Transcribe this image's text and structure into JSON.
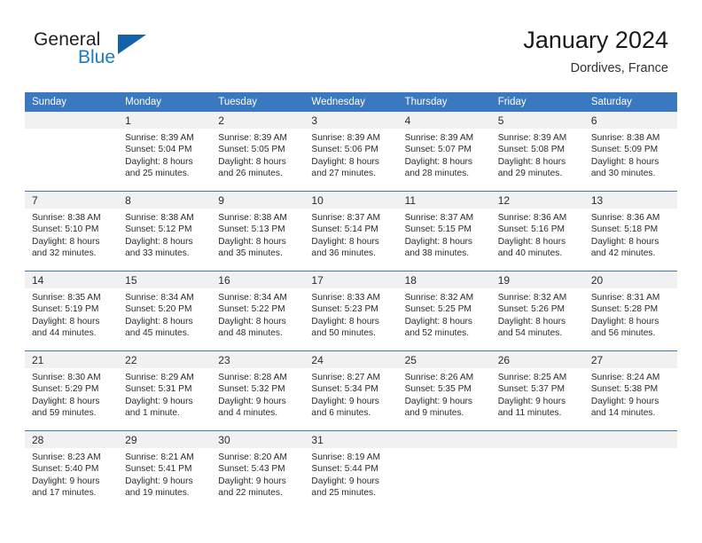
{
  "brand": {
    "word_general": "General",
    "word_blue": "Blue"
  },
  "header": {
    "title": "January 2024",
    "subtitle": "Dordives, France"
  },
  "colors": {
    "header_blue": "#3a78bf",
    "brand_blue": "#1a7bc4",
    "daynum_band": "#f1f1f1",
    "text": "#2b2b2b"
  },
  "weekdays": [
    "Sunday",
    "Monday",
    "Tuesday",
    "Wednesday",
    "Thursday",
    "Friday",
    "Saturday"
  ],
  "weeks": [
    [
      {
        "day": "",
        "sunrise": "",
        "sunset": "",
        "daylight1": "",
        "daylight2": ""
      },
      {
        "day": "1",
        "sunrise": "Sunrise: 8:39 AM",
        "sunset": "Sunset: 5:04 PM",
        "daylight1": "Daylight: 8 hours",
        "daylight2": "and 25 minutes."
      },
      {
        "day": "2",
        "sunrise": "Sunrise: 8:39 AM",
        "sunset": "Sunset: 5:05 PM",
        "daylight1": "Daylight: 8 hours",
        "daylight2": "and 26 minutes."
      },
      {
        "day": "3",
        "sunrise": "Sunrise: 8:39 AM",
        "sunset": "Sunset: 5:06 PM",
        "daylight1": "Daylight: 8 hours",
        "daylight2": "and 27 minutes."
      },
      {
        "day": "4",
        "sunrise": "Sunrise: 8:39 AM",
        "sunset": "Sunset: 5:07 PM",
        "daylight1": "Daylight: 8 hours",
        "daylight2": "and 28 minutes."
      },
      {
        "day": "5",
        "sunrise": "Sunrise: 8:39 AM",
        "sunset": "Sunset: 5:08 PM",
        "daylight1": "Daylight: 8 hours",
        "daylight2": "and 29 minutes."
      },
      {
        "day": "6",
        "sunrise": "Sunrise: 8:38 AM",
        "sunset": "Sunset: 5:09 PM",
        "daylight1": "Daylight: 8 hours",
        "daylight2": "and 30 minutes."
      }
    ],
    [
      {
        "day": "7",
        "sunrise": "Sunrise: 8:38 AM",
        "sunset": "Sunset: 5:10 PM",
        "daylight1": "Daylight: 8 hours",
        "daylight2": "and 32 minutes."
      },
      {
        "day": "8",
        "sunrise": "Sunrise: 8:38 AM",
        "sunset": "Sunset: 5:12 PM",
        "daylight1": "Daylight: 8 hours",
        "daylight2": "and 33 minutes."
      },
      {
        "day": "9",
        "sunrise": "Sunrise: 8:38 AM",
        "sunset": "Sunset: 5:13 PM",
        "daylight1": "Daylight: 8 hours",
        "daylight2": "and 35 minutes."
      },
      {
        "day": "10",
        "sunrise": "Sunrise: 8:37 AM",
        "sunset": "Sunset: 5:14 PM",
        "daylight1": "Daylight: 8 hours",
        "daylight2": "and 36 minutes."
      },
      {
        "day": "11",
        "sunrise": "Sunrise: 8:37 AM",
        "sunset": "Sunset: 5:15 PM",
        "daylight1": "Daylight: 8 hours",
        "daylight2": "and 38 minutes."
      },
      {
        "day": "12",
        "sunrise": "Sunrise: 8:36 AM",
        "sunset": "Sunset: 5:16 PM",
        "daylight1": "Daylight: 8 hours",
        "daylight2": "and 40 minutes."
      },
      {
        "day": "13",
        "sunrise": "Sunrise: 8:36 AM",
        "sunset": "Sunset: 5:18 PM",
        "daylight1": "Daylight: 8 hours",
        "daylight2": "and 42 minutes."
      }
    ],
    [
      {
        "day": "14",
        "sunrise": "Sunrise: 8:35 AM",
        "sunset": "Sunset: 5:19 PM",
        "daylight1": "Daylight: 8 hours",
        "daylight2": "and 44 minutes."
      },
      {
        "day": "15",
        "sunrise": "Sunrise: 8:34 AM",
        "sunset": "Sunset: 5:20 PM",
        "daylight1": "Daylight: 8 hours",
        "daylight2": "and 45 minutes."
      },
      {
        "day": "16",
        "sunrise": "Sunrise: 8:34 AM",
        "sunset": "Sunset: 5:22 PM",
        "daylight1": "Daylight: 8 hours",
        "daylight2": "and 48 minutes."
      },
      {
        "day": "17",
        "sunrise": "Sunrise: 8:33 AM",
        "sunset": "Sunset: 5:23 PM",
        "daylight1": "Daylight: 8 hours",
        "daylight2": "and 50 minutes."
      },
      {
        "day": "18",
        "sunrise": "Sunrise: 8:32 AM",
        "sunset": "Sunset: 5:25 PM",
        "daylight1": "Daylight: 8 hours",
        "daylight2": "and 52 minutes."
      },
      {
        "day": "19",
        "sunrise": "Sunrise: 8:32 AM",
        "sunset": "Sunset: 5:26 PM",
        "daylight1": "Daylight: 8 hours",
        "daylight2": "and 54 minutes."
      },
      {
        "day": "20",
        "sunrise": "Sunrise: 8:31 AM",
        "sunset": "Sunset: 5:28 PM",
        "daylight1": "Daylight: 8 hours",
        "daylight2": "and 56 minutes."
      }
    ],
    [
      {
        "day": "21",
        "sunrise": "Sunrise: 8:30 AM",
        "sunset": "Sunset: 5:29 PM",
        "daylight1": "Daylight: 8 hours",
        "daylight2": "and 59 minutes."
      },
      {
        "day": "22",
        "sunrise": "Sunrise: 8:29 AM",
        "sunset": "Sunset: 5:31 PM",
        "daylight1": "Daylight: 9 hours",
        "daylight2": "and 1 minute."
      },
      {
        "day": "23",
        "sunrise": "Sunrise: 8:28 AM",
        "sunset": "Sunset: 5:32 PM",
        "daylight1": "Daylight: 9 hours",
        "daylight2": "and 4 minutes."
      },
      {
        "day": "24",
        "sunrise": "Sunrise: 8:27 AM",
        "sunset": "Sunset: 5:34 PM",
        "daylight1": "Daylight: 9 hours",
        "daylight2": "and 6 minutes."
      },
      {
        "day": "25",
        "sunrise": "Sunrise: 8:26 AM",
        "sunset": "Sunset: 5:35 PM",
        "daylight1": "Daylight: 9 hours",
        "daylight2": "and 9 minutes."
      },
      {
        "day": "26",
        "sunrise": "Sunrise: 8:25 AM",
        "sunset": "Sunset: 5:37 PM",
        "daylight1": "Daylight: 9 hours",
        "daylight2": "and 11 minutes."
      },
      {
        "day": "27",
        "sunrise": "Sunrise: 8:24 AM",
        "sunset": "Sunset: 5:38 PM",
        "daylight1": "Daylight: 9 hours",
        "daylight2": "and 14 minutes."
      }
    ],
    [
      {
        "day": "28",
        "sunrise": "Sunrise: 8:23 AM",
        "sunset": "Sunset: 5:40 PM",
        "daylight1": "Daylight: 9 hours",
        "daylight2": "and 17 minutes."
      },
      {
        "day": "29",
        "sunrise": "Sunrise: 8:21 AM",
        "sunset": "Sunset: 5:41 PM",
        "daylight1": "Daylight: 9 hours",
        "daylight2": "and 19 minutes."
      },
      {
        "day": "30",
        "sunrise": "Sunrise: 8:20 AM",
        "sunset": "Sunset: 5:43 PM",
        "daylight1": "Daylight: 9 hours",
        "daylight2": "and 22 minutes."
      },
      {
        "day": "31",
        "sunrise": "Sunrise: 8:19 AM",
        "sunset": "Sunset: 5:44 PM",
        "daylight1": "Daylight: 9 hours",
        "daylight2": "and 25 minutes."
      },
      {
        "day": "",
        "sunrise": "",
        "sunset": "",
        "daylight1": "",
        "daylight2": ""
      },
      {
        "day": "",
        "sunrise": "",
        "sunset": "",
        "daylight1": "",
        "daylight2": ""
      },
      {
        "day": "",
        "sunrise": "",
        "sunset": "",
        "daylight1": "",
        "daylight2": ""
      }
    ]
  ]
}
